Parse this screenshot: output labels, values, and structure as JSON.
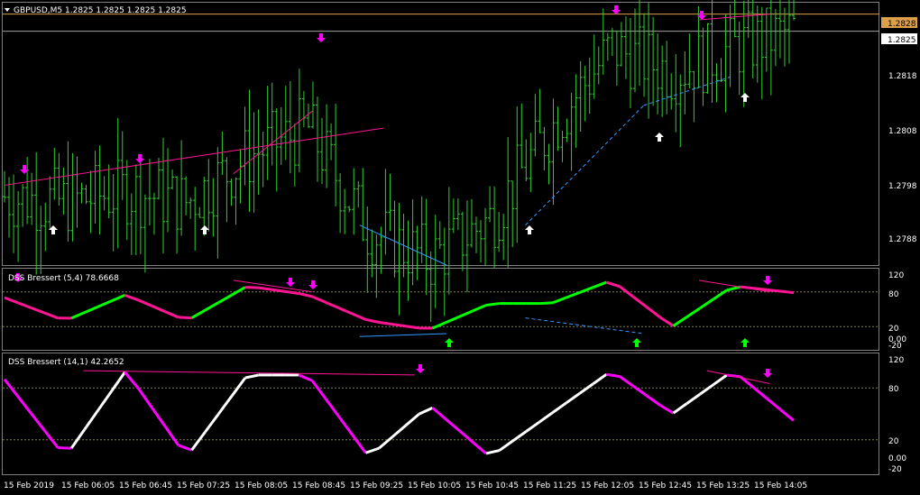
{
  "main": {
    "header": "GBPUSD,M5  1.2825 1.2825 1.2825 1.2825",
    "ticks": [
      "1.2818",
      "1.2808",
      "1.2798",
      "1.2788"
    ],
    "badge_ask": "1.2828",
    "badge_bid": "1.2825"
  },
  "ind1": {
    "label": "DSS Bressert (5,4) 78.6668",
    "ticks": [
      "120",
      "80",
      "20",
      "0.00",
      "-20"
    ]
  },
  "ind2": {
    "label": "DSS Bressert (14,1) 42.2652",
    "ticks": [
      "120",
      "80",
      "20",
      "0.00",
      "-20"
    ]
  },
  "time_labels": [
    "15 Feb 2019",
    "15 Feb 06:05",
    "15 Feb 06:45",
    "15 Feb 07:25",
    "15 Feb 08:05",
    "15 Feb 08:45",
    "15 Feb 09:25",
    "15 Feb 10:05",
    "15 Feb 10:45",
    "15 Feb 11:25",
    "15 Feb 12:05",
    "15 Feb 12:45",
    "15 Feb 13:25",
    "15 Feb 14:05"
  ],
  "colors": {
    "bull": "#32cd32",
    "bear": "#ff1493",
    "dss1_up": "#00ff00",
    "dss2_up": "#ffffff",
    "dss2_dn": "#ff00ff",
    "arrow_up": "#ffffff",
    "arrow_dn": "#ff00ff",
    "div_blue": "#3399ff"
  },
  "chart_data": [
    {
      "type": "line",
      "title": "GBPUSD,M5",
      "x": [
        "15 Feb 2019",
        "15 Feb 06:05",
        "15 Feb 06:45",
        "15 Feb 07:25",
        "15 Feb 08:05",
        "15 Feb 08:45",
        "15 Feb 09:25",
        "15 Feb 10:05",
        "15 Feb 10:45",
        "15 Feb 11:25",
        "15 Feb 12:05",
        "15 Feb 12:45",
        "15 Feb 13:25",
        "15 Feb 14:05"
      ],
      "series": [
        {
          "name": "GBPUSD,M5",
          "values": [
            1.2796,
            1.2795,
            1.2797,
            1.2795,
            1.2803,
            1.2808,
            1.279,
            1.2785,
            1.2792,
            1.2808,
            1.2822,
            1.2818,
            1.2822,
            1.2825
          ]
        }
      ],
      "ylim": [
        1.2784,
        1.283
      ],
      "price_lines": [
        1.2828,
        1.2825
      ]
    },
    {
      "type": "line",
      "title": "DSS Bressert (5,4)",
      "x": [
        "15 Feb 2019",
        "15 Feb 06:05",
        "15 Feb 06:45",
        "15 Feb 07:25",
        "15 Feb 08:05",
        "15 Feb 08:45",
        "15 Feb 09:25",
        "15 Feb 10:05",
        "15 Feb 10:45",
        "15 Feb 11:25",
        "15 Feb 12:05",
        "15 Feb 12:45",
        "15 Feb 13:25",
        "15 Feb 14:05"
      ],
      "series": [
        {
          "name": "DSS Bressert (5,4)",
          "values": [
            70,
            30,
            75,
            30,
            90,
            75,
            30,
            15,
            60,
            60,
            100,
            20,
            90,
            78.6668
          ]
        }
      ],
      "levels": [
        80,
        20
      ],
      "ylim": [
        -20,
        120
      ]
    },
    {
      "type": "line",
      "title": "DSS Bressert (14,1)",
      "x": [
        "15 Feb 2019",
        "15 Feb 06:05",
        "15 Feb 06:45",
        "15 Feb 07:25",
        "15 Feb 08:05",
        "15 Feb 08:45",
        "15 Feb 09:25",
        "15 Feb 10:05",
        "15 Feb 10:45",
        "15 Feb 11:25",
        "15 Feb 12:05",
        "15 Feb 12:45",
        "15 Feb 13:25",
        "15 Feb 14:05"
      ],
      "series": [
        {
          "name": "DSS Bressert (14,1)",
          "values": [
            90,
            0,
            100,
            0,
            95,
            95,
            0,
            60,
            0,
            50,
            100,
            50,
            100,
            42.2652
          ]
        }
      ],
      "levels": [
        80,
        20
      ],
      "ylim": [
        -20,
        120
      ]
    }
  ]
}
